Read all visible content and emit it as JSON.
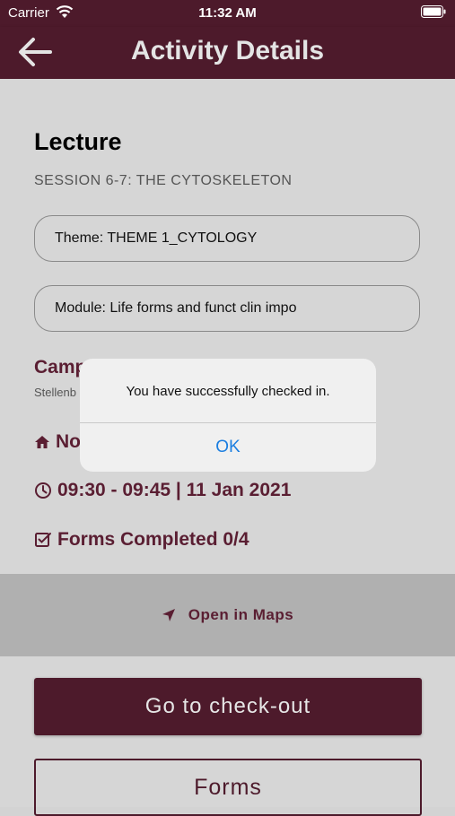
{
  "status_bar": {
    "carrier": "Carrier",
    "time": "11:32 AM"
  },
  "nav": {
    "title": "Activity Details"
  },
  "activity": {
    "type": "Lecture",
    "session": "SESSION 6-7: THE CYTOSKELETON",
    "theme": "Theme: THEME 1_CYTOLOGY",
    "module": "Module: Life forms and funct clin impo",
    "campus_partial": "Camp",
    "campus_sub_partial": "Stellenb",
    "venue_partial": "No",
    "time_date": "09:30 - 09:45 | 11 Jan 2021",
    "forms_completed": "Forms Completed 0/4"
  },
  "maps": {
    "label": "Open in Maps"
  },
  "buttons": {
    "checkout": "Go to check-out",
    "forms": "Forms"
  },
  "alert": {
    "message": "You have successfully checked in.",
    "ok": "OK"
  },
  "colors": {
    "brand": "#4d1a2b",
    "accent_text": "#5a1e32",
    "link_blue": "#1b7ee0"
  }
}
